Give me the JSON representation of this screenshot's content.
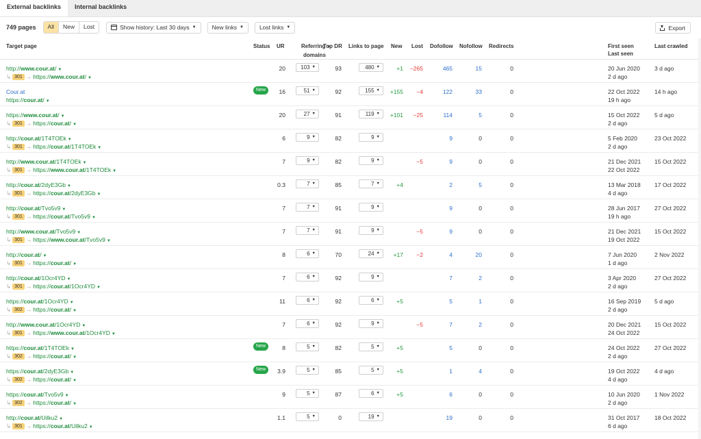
{
  "tabs": [
    {
      "label": "External backlinks",
      "active": true
    },
    {
      "label": "Internal backlinks",
      "active": false
    }
  ],
  "toolbar": {
    "count": "749 pages",
    "filters": [
      {
        "label": "All",
        "active": true
      },
      {
        "label": "New",
        "active": false
      },
      {
        "label": "Lost",
        "active": false
      }
    ],
    "history_label": "Show history: Last 30 days",
    "new_links_label": "New links",
    "lost_links_label": "Lost links",
    "export_label": "Export"
  },
  "columns": {
    "target_page": "Target page",
    "status": "Status",
    "ur": "UR",
    "referring_domains_1": "Referring",
    "referring_domains_2": "domains",
    "top_dr": "Top DR",
    "links_to_page": "Links to page",
    "new": "New",
    "lost": "Lost",
    "dofollow": "Dofollow",
    "nofollow": "Nofollow",
    "redirects": "Redirects",
    "first_seen": "First seen",
    "last_seen": "Last seen",
    "last_crawled": "Last crawled"
  },
  "colors": {
    "accent_green": "#1d8b3a",
    "link_blue": "#2c6fc9",
    "lost_red": "#e53935",
    "code_yellow": "#f7d27a",
    "new_badge": "#26a54a"
  },
  "rows": [
    {
      "pre": "http://",
      "domain": "www.cour.at",
      "path": "/",
      "redir_code": "301",
      "redir_pre": "https://",
      "redir_domain": "www.cour.at",
      "redir_path": "/",
      "status": "",
      "ur": "20",
      "ref": "103",
      "dr": "93",
      "links": "480",
      "new": "+1",
      "lost": "−265",
      "dofollow": "465",
      "nofollow": "15",
      "redirects": "0",
      "first_seen": "20 Jun 2020",
      "last_seen": "2 d ago",
      "last_crawled": "3 d ago"
    },
    {
      "title": "Cour.at",
      "pre": "https://",
      "domain": "cour.at",
      "path": "/",
      "redir_code": "",
      "status": "New",
      "ur": "16",
      "ref": "51",
      "dr": "92",
      "links": "155",
      "new": "+155",
      "lost": "−4",
      "dofollow": "122",
      "nofollow": "33",
      "redirects": "0",
      "first_seen": "22 Oct 2022",
      "last_seen": "19 h ago",
      "last_crawled": "14 h ago"
    },
    {
      "pre": "https://",
      "domain": "www.cour.at",
      "path": "/",
      "redir_code": "301",
      "redir_pre": "https://",
      "redir_domain": "cour.at",
      "redir_path": "/",
      "status": "",
      "ur": "20",
      "ref": "27",
      "dr": "91",
      "links": "119",
      "new": "+101",
      "lost": "−25",
      "dofollow": "114",
      "nofollow": "5",
      "redirects": "0",
      "first_seen": "15 Oct 2022",
      "last_seen": "2 d ago",
      "last_crawled": "5 d ago"
    },
    {
      "pre": "http://",
      "domain": "cour.at",
      "path": "/1T4TOEk",
      "redir_code": "301",
      "redir_pre": "https://",
      "redir_domain": "cour.at",
      "redir_path": "/1T4TOEk",
      "status": "",
      "ur": "6",
      "ref": "9",
      "dr": "82",
      "links": "9",
      "new": "",
      "lost": "",
      "dofollow": "9",
      "nofollow": "0",
      "redirects": "0",
      "first_seen": "5 Feb 2020",
      "last_seen": "2 d ago",
      "last_crawled": "23 Oct 2022"
    },
    {
      "pre": "http://",
      "domain": "www.cour.at",
      "path": "/1T4TOEk",
      "redir_code": "301",
      "redir_pre": "https://",
      "redir_domain": "www.cour.at",
      "redir_path": "/1T4TOEk",
      "status": "",
      "ur": "7",
      "ref": "9",
      "dr": "82",
      "links": "9",
      "new": "",
      "lost": "−5",
      "dofollow": "9",
      "nofollow": "0",
      "redirects": "0",
      "first_seen": "21 Dec 2021",
      "last_seen": "22 Oct 2022",
      "last_crawled": "15 Oct 2022"
    },
    {
      "pre": "http://",
      "domain": "cour.at",
      "path": "/2dyE3Gb",
      "redir_code": "301",
      "redir_pre": "https://",
      "redir_domain": "cour.at",
      "redir_path": "/2dyE3Gb",
      "status": "",
      "ur": "0.3",
      "ref": "7",
      "dr": "85",
      "links": "7",
      "new": "+4",
      "lost": "",
      "dofollow": "2",
      "nofollow": "5",
      "redirects": "0",
      "first_seen": "13 Mar 2018",
      "last_seen": "4 d ago",
      "last_crawled": "17 Oct 2022"
    },
    {
      "pre": "http://",
      "domain": "cour.at",
      "path": "/Tvo5v9",
      "redir_code": "301",
      "redir_pre": "https://",
      "redir_domain": "cour.at",
      "redir_path": "/Tvo5v9",
      "status": "",
      "ur": "7",
      "ref": "7",
      "dr": "91",
      "links": "9",
      "new": "",
      "lost": "",
      "dofollow": "9",
      "nofollow": "0",
      "redirects": "0",
      "first_seen": "28 Jun 2017",
      "last_seen": "19 h ago",
      "last_crawled": "27 Oct 2022"
    },
    {
      "pre": "http://",
      "domain": "www.cour.at",
      "path": "/Tvo5v9",
      "redir_code": "301",
      "redir_pre": "https://",
      "redir_domain": "www.cour.at",
      "redir_path": "/Tvo5v9",
      "status": "",
      "ur": "7",
      "ref": "7",
      "dr": "91",
      "links": "9",
      "new": "",
      "lost": "−5",
      "dofollow": "9",
      "nofollow": "0",
      "redirects": "0",
      "first_seen": "21 Dec 2021",
      "last_seen": "19 Oct 2022",
      "last_crawled": "15 Oct 2022"
    },
    {
      "pre": "http://",
      "domain": "cour.at",
      "path": "/",
      "redir_code": "301",
      "redir_pre": "https://",
      "redir_domain": "cour.at",
      "redir_path": "/",
      "status": "",
      "ur": "8",
      "ref": "6",
      "dr": "70",
      "links": "24",
      "new": "+17",
      "lost": "−2",
      "dofollow": "4",
      "nofollow": "20",
      "redirects": "0",
      "first_seen": "7 Jun 2020",
      "last_seen": "1 d ago",
      "last_crawled": "2 Nov 2022"
    },
    {
      "pre": "http://",
      "domain": "cour.at",
      "path": "/1Ocr4YD",
      "redir_code": "301",
      "redir_pre": "https://",
      "redir_domain": "cour.at",
      "redir_path": "/1Ocr4YD",
      "status": "",
      "ur": "7",
      "ref": "6",
      "dr": "92",
      "links": "9",
      "new": "",
      "lost": "",
      "dofollow": "7",
      "nofollow": "2",
      "redirects": "0",
      "first_seen": "3 Apr 2020",
      "last_seen": "2 d ago",
      "last_crawled": "27 Oct 2022"
    },
    {
      "pre": "https://",
      "domain": "cour.at",
      "path": "/1Ocr4YD",
      "redir_code": "302",
      "redir_pre": "https://",
      "redir_domain": "cour.at",
      "redir_path": "/",
      "status": "",
      "ur": "11",
      "ref": "6",
      "dr": "92",
      "links": "6",
      "new": "+5",
      "lost": "",
      "dofollow": "5",
      "nofollow": "1",
      "redirects": "0",
      "first_seen": "16 Sep 2019",
      "last_seen": "2 d ago",
      "last_crawled": "5 d ago"
    },
    {
      "pre": "http://",
      "domain": "www.cour.at",
      "path": "/1Ocr4YD",
      "redir_code": "301",
      "redir_pre": "https://",
      "redir_domain": "www.cour.at",
      "redir_path": "/1Ocr4YD",
      "status": "",
      "ur": "7",
      "ref": "6",
      "dr": "92",
      "links": "9",
      "new": "",
      "lost": "−5",
      "dofollow": "7",
      "nofollow": "2",
      "redirects": "0",
      "first_seen": "20 Dec 2021",
      "last_seen": "24 Oct 2022",
      "last_crawled": "15 Oct 2022"
    },
    {
      "pre": "https://",
      "domain": "cour.at",
      "path": "/1T4TOEk",
      "redir_code": "302",
      "redir_pre": "https://",
      "redir_domain": "cour.at",
      "redir_path": "/",
      "status": "New",
      "ur": "8",
      "ref": "5",
      "dr": "82",
      "links": "5",
      "new": "+5",
      "lost": "",
      "dofollow": "5",
      "nofollow": "0",
      "redirects": "0",
      "first_seen": "24 Oct 2022",
      "last_seen": "2 d ago",
      "last_crawled": "27 Oct 2022"
    },
    {
      "pre": "https://",
      "domain": "cour.at",
      "path": "/2dyE3Gb",
      "redir_code": "302",
      "redir_pre": "https://",
      "redir_domain": "cour.at",
      "redir_path": "/",
      "status": "New",
      "ur": "3.9",
      "ref": "5",
      "dr": "85",
      "links": "5",
      "new": "+5",
      "lost": "",
      "dofollow": "1",
      "nofollow": "4",
      "redirects": "0",
      "first_seen": "19 Oct 2022",
      "last_seen": "4 d ago",
      "last_crawled": "4 d ago"
    },
    {
      "pre": "https://",
      "domain": "cour.at",
      "path": "/Tvo5v9",
      "redir_code": "302",
      "redir_pre": "https://",
      "redir_domain": "cour.at",
      "redir_path": "/",
      "status": "",
      "ur": "9",
      "ref": "5",
      "dr": "87",
      "links": "6",
      "new": "+5",
      "lost": "",
      "dofollow": "6",
      "nofollow": "0",
      "redirects": "0",
      "first_seen": "10 Jun 2020",
      "last_seen": "2 d ago",
      "last_crawled": "1 Nov 2022"
    },
    {
      "pre": "http://",
      "domain": "cour.at",
      "path": "/Uilku2",
      "redir_code": "301",
      "redir_pre": "https://",
      "redir_domain": "cour.at",
      "redir_path": "/Uilku2",
      "status": "",
      "ur": "1.1",
      "ref": "5",
      "dr": "0",
      "links": "19",
      "new": "",
      "lost": "",
      "dofollow": "19",
      "nofollow": "0",
      "redirects": "0",
      "first_seen": "31 Oct 2017",
      "last_seen": "6 d ago",
      "last_crawled": "18 Oct 2022"
    }
  ]
}
